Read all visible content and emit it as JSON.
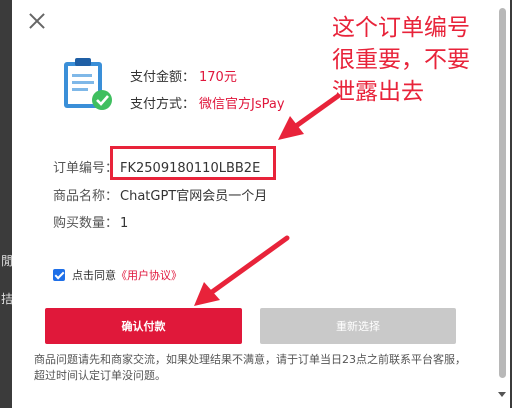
{
  "backdrop": {
    "frag1": "閒",
    "frag2": "拮"
  },
  "payment": {
    "amount_label": "支付金额：",
    "amount_value": "170元",
    "method_label": "支付方式：",
    "method_value": "微信官方JsPay"
  },
  "order": {
    "number_label": "订单编号：",
    "number_value": "FK2509180110LBB2E",
    "product_label": "商品名称：",
    "product_value": "ChatGPT官网会员一个月",
    "qty_label": "购买数量：",
    "qty_value": "1"
  },
  "agreement": {
    "text": "点击同意",
    "link": "《用户协议》",
    "checked": true
  },
  "buttons": {
    "confirm": "确认付款",
    "reselect": "重新选择"
  },
  "notice": "商品问题请先和商家交流，如果处理结果不满意，请于订单当日23点之前联系平台客服，超过时间认定订单没问题。",
  "annotation": {
    "line1": "这个订单编号",
    "line2": "很重要，不要",
    "line3": "泄露出去"
  },
  "colors": {
    "accent": "#e0183a",
    "annotation": "#e8233a",
    "checkbox": "#1e6fe8"
  }
}
